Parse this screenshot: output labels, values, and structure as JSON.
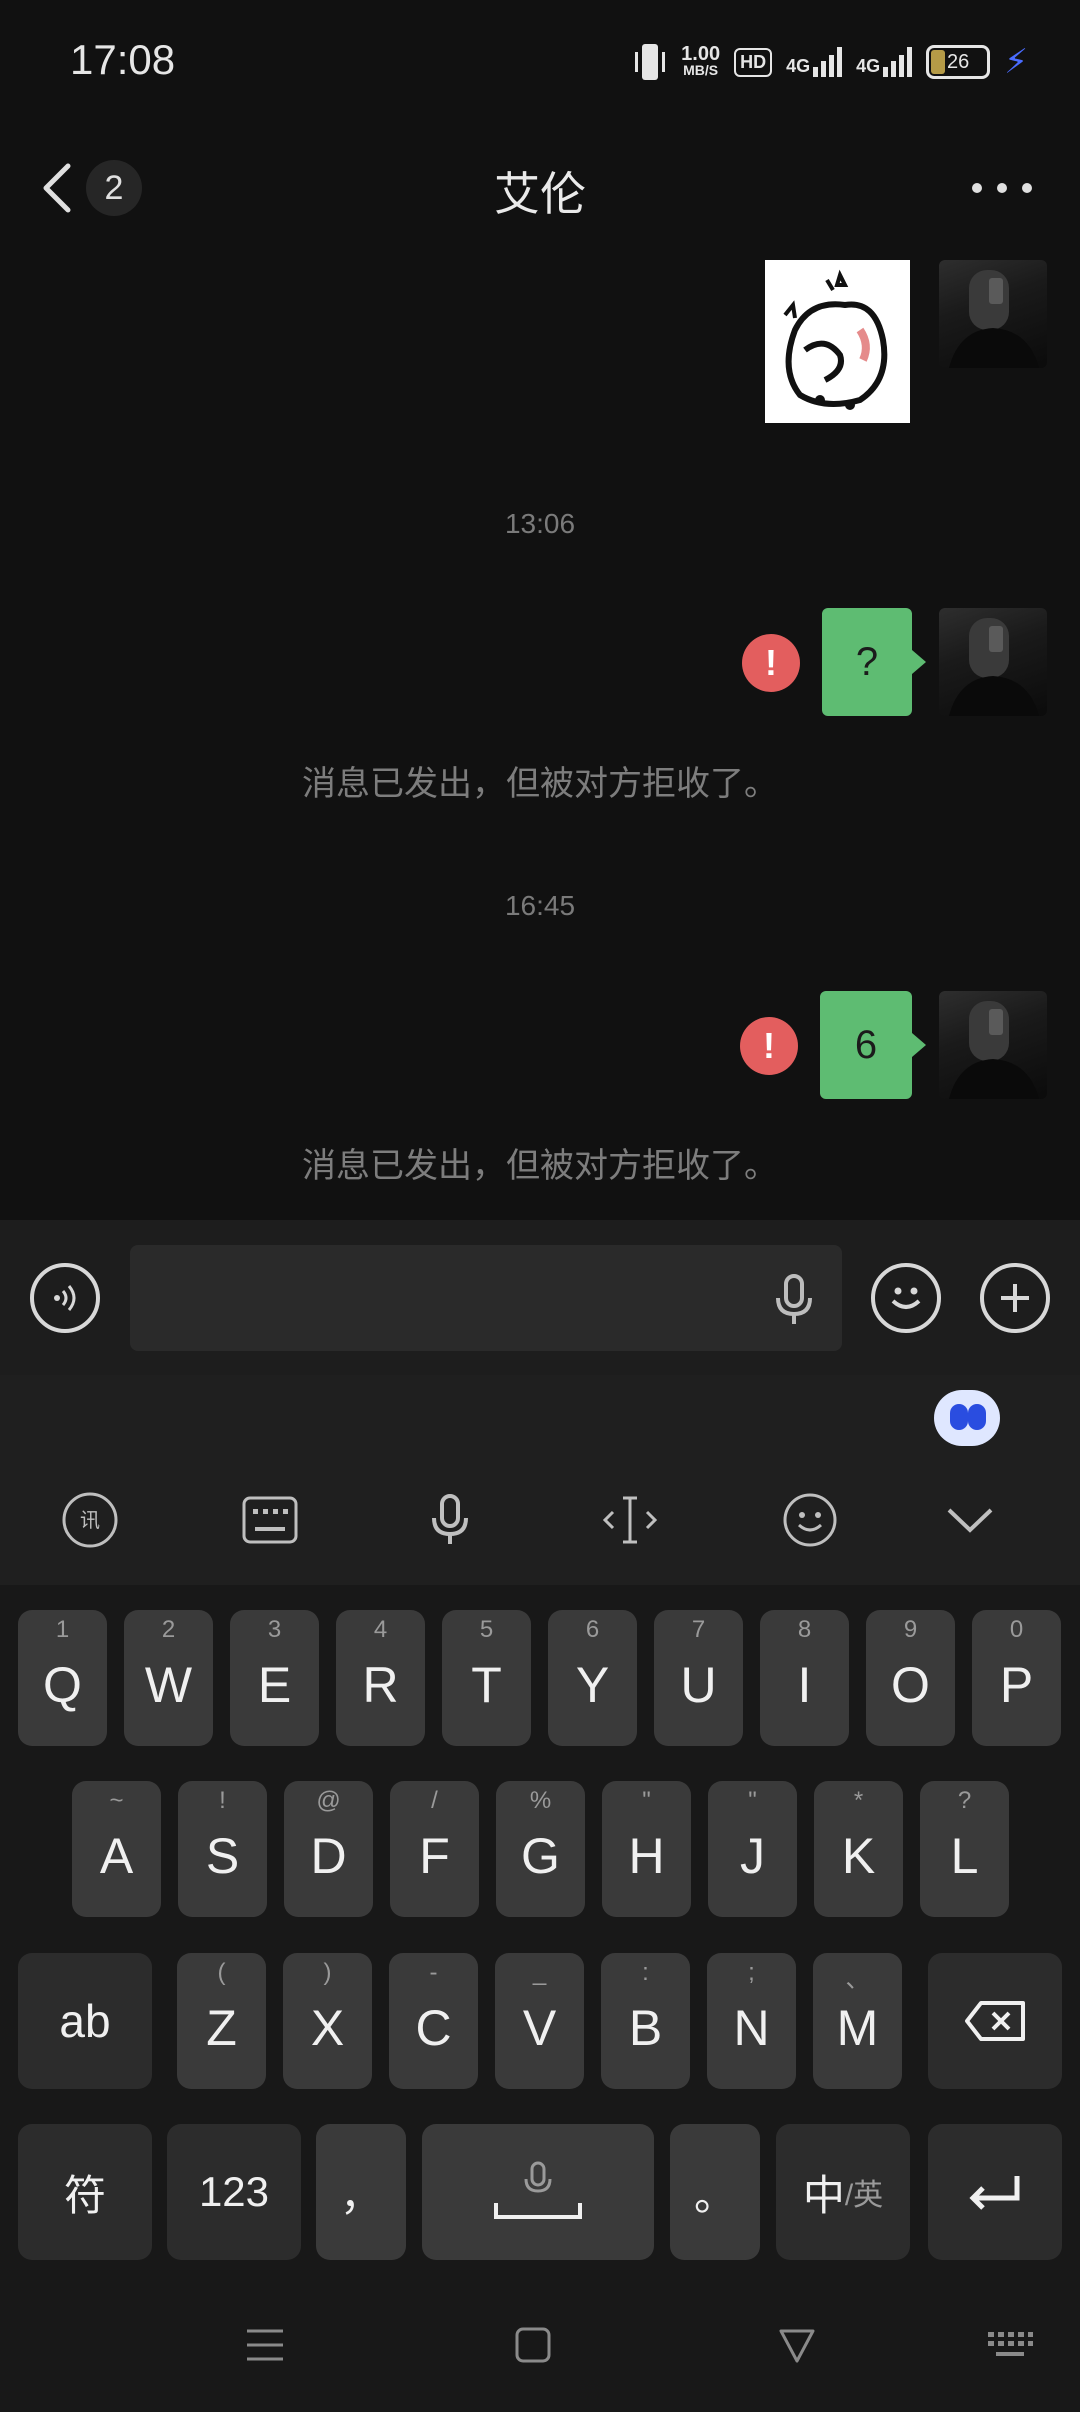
{
  "status_bar": {
    "time": "17:08",
    "net_speed_value": "1.00",
    "net_speed_unit": "MB/S",
    "hd_label": "HD",
    "net_label_1": "4G",
    "net_label_2": "4G",
    "battery": "26"
  },
  "header": {
    "unread_count": "2",
    "title": "艾伦"
  },
  "messages": {
    "timestamp_1": "13:06",
    "msg_1_text": "?",
    "system_1": "消息已发出，但被对方拒收了。",
    "timestamp_2": "16:45",
    "msg_2_text": "6",
    "system_2": "消息已发出，但被对方拒收了。",
    "error_mark": "!"
  },
  "keyboard": {
    "row1": [
      {
        "hint": "1",
        "key": "Q"
      },
      {
        "hint": "2",
        "key": "W"
      },
      {
        "hint": "3",
        "key": "E"
      },
      {
        "hint": "4",
        "key": "R"
      },
      {
        "hint": "5",
        "key": "T"
      },
      {
        "hint": "6",
        "key": "Y"
      },
      {
        "hint": "7",
        "key": "U"
      },
      {
        "hint": "8",
        "key": "I"
      },
      {
        "hint": "9",
        "key": "O"
      },
      {
        "hint": "0",
        "key": "P"
      }
    ],
    "row2": [
      {
        "hint": "~",
        "key": "A"
      },
      {
        "hint": "!",
        "key": "S"
      },
      {
        "hint": "@",
        "key": "D"
      },
      {
        "hint": "/",
        "key": "F"
      },
      {
        "hint": "%",
        "key": "G"
      },
      {
        "hint": "\"",
        "key": "H"
      },
      {
        "hint": "\"",
        "key": "J"
      },
      {
        "hint": "*",
        "key": "K"
      },
      {
        "hint": "?",
        "key": "L"
      }
    ],
    "row3": [
      {
        "hint": "(",
        "key": "Z"
      },
      {
        "hint": ")",
        "key": "X"
      },
      {
        "hint": "-",
        "key": "C"
      },
      {
        "hint": "_",
        "key": "V"
      },
      {
        "hint": ":",
        "key": "B"
      },
      {
        "hint": ";",
        "key": "N"
      },
      {
        "hint": "、",
        "key": "M"
      }
    ],
    "ab_label": "ab",
    "symbol_label": "符",
    "num_label": "123",
    "comma_label": "，",
    "period_label": "。",
    "zh_label": "中",
    "en_label": "/英"
  }
}
